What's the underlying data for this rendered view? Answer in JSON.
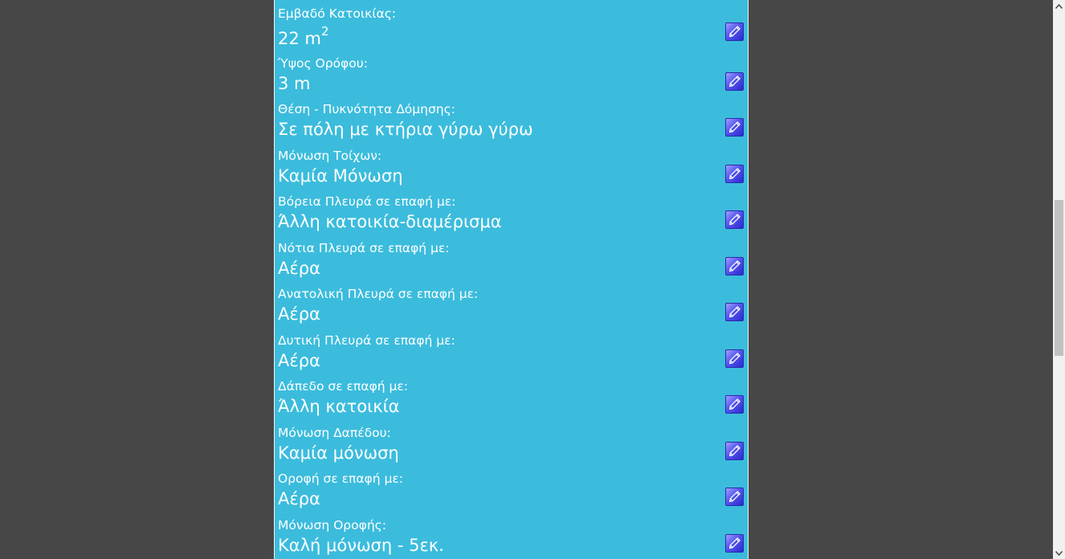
{
  "form": {
    "rows": [
      {
        "label": "Εμβαδό Κατοικίας:",
        "value": "22 m",
        "value_sup": "2"
      },
      {
        "label": "Ύψος Ορόφου:",
        "value": "3 m"
      },
      {
        "label": "Θέση - Πυκνότητα Δόμησης:",
        "value": "Σε πόλη με κτήρια γύρω γύρω"
      },
      {
        "label": "Μόνωση Τοίχων:",
        "value": "Καμία Μόνωση"
      },
      {
        "label": "Βόρεια Πλευρά σε επαφή με:",
        "value": "Άλλη κατοικία-διαμέρισμα"
      },
      {
        "label": "Νότια Πλευρά σε επαφή με:",
        "value": "Αέρα"
      },
      {
        "label": "Ανατολική Πλευρά σε επαφή με:",
        "value": "Αέρα"
      },
      {
        "label": "Δυτική Πλευρά σε επαφή με:",
        "value": "Αέρα"
      },
      {
        "label": "Δάπεδο σε επαφή με:",
        "value": "Άλλη κατοικία"
      },
      {
        "label": "Μόνωση Δαπέδου:",
        "value": "Καμία μόνωση"
      },
      {
        "label": "Οροφή σε επαφή με:",
        "value": "Αέρα"
      },
      {
        "label": "Μόνωση Οροφής:",
        "value": "Καλή μόνωση - 5εκ."
      }
    ],
    "edit_icon": "pencil-icon"
  },
  "colors": {
    "page_background": "#474747",
    "panel_background": "#3bbcdd",
    "text": "#ffffff",
    "edit_button": "#5555ee"
  },
  "scrollbar": {
    "position_fraction": 0.36
  }
}
